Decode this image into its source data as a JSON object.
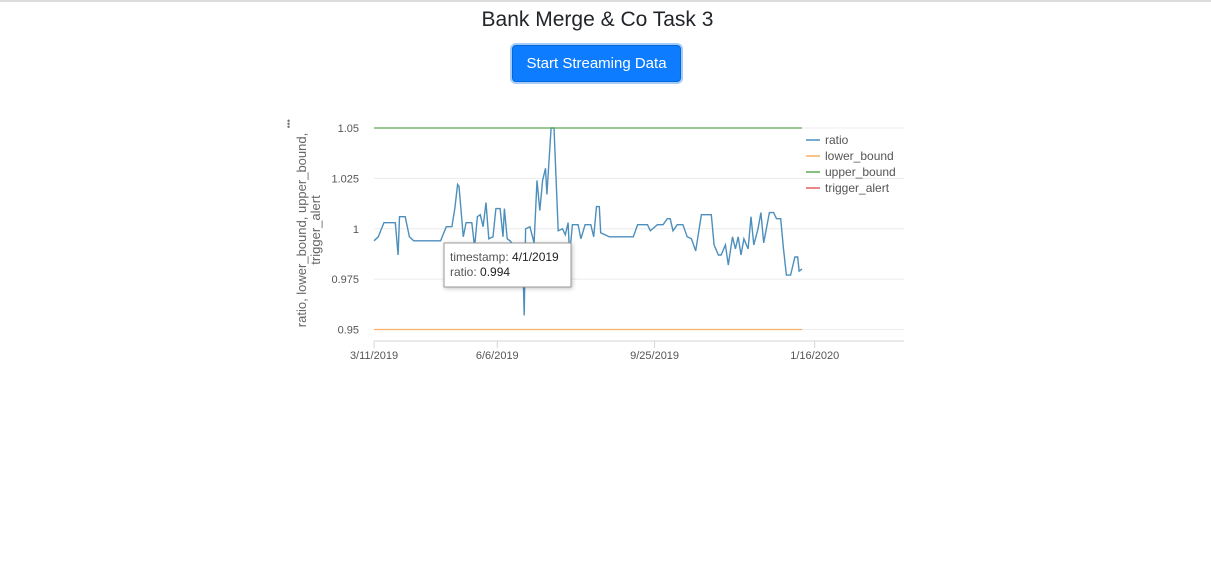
{
  "page": {
    "title": "Bank Merge & Co Task 3",
    "stream_button": "Start Streaming Data"
  },
  "colors": {
    "ratio": "#4c8fbd",
    "lower_bound": "#f5b065",
    "upper_bound": "#5cab52",
    "trigger_alert": "#e06060",
    "button": "#0d7cff"
  },
  "chart_data": {
    "type": "line",
    "title": "",
    "ylabel": "ratio, lower_bound, upper_bound, trigger_alert",
    "xlabel": "",
    "ylim": [
      0.9443,
      1.05
    ],
    "yticks": [
      "0.95",
      "0.975",
      "1",
      "1.025",
      "1.05"
    ],
    "xticks": [
      "3/11/2019",
      "6/6/2019",
      "9/25/2019",
      "1/16/2020"
    ],
    "x_range": [
      "2019-03-11",
      "2020-03-19"
    ],
    "grid": true,
    "legend_position": "top-right",
    "legend": [
      "ratio",
      "lower_bound",
      "upper_bound",
      "trigger_alert"
    ],
    "tooltip": {
      "timestamp_label": "timestamp:",
      "timestamp": "4/1/2019",
      "ratio_label": "ratio:",
      "ratio": "0.994"
    },
    "series": [
      {
        "name": "ratio",
        "points": [
          [
            "2019-03-11",
            0.994
          ],
          [
            "2019-03-14",
            0.996
          ],
          [
            "2019-03-18",
            1.003
          ],
          [
            "2019-03-26",
            1.003
          ],
          [
            "2019-03-28",
            0.987
          ],
          [
            "2019-03-29",
            1.006
          ],
          [
            "2019-04-02",
            1.006
          ],
          [
            "2019-04-05",
            0.996
          ],
          [
            "2019-04-08",
            0.994
          ],
          [
            "2019-04-20",
            0.994
          ],
          [
            "2019-04-27",
            0.994
          ],
          [
            "2019-05-01",
            1.001
          ],
          [
            "2019-05-05",
            1.001
          ],
          [
            "2019-05-07",
            1.01
          ],
          [
            "2019-05-09",
            1.022
          ],
          [
            "2019-05-10",
            1.021
          ],
          [
            "2019-05-13",
            0.996
          ],
          [
            "2019-05-15",
            1.003
          ],
          [
            "2019-05-19",
            1.003
          ],
          [
            "2019-05-21",
            0.991
          ],
          [
            "2019-05-23",
            1.006
          ],
          [
            "2019-05-25",
            1.007
          ],
          [
            "2019-05-27",
            1.001
          ],
          [
            "2019-05-29",
            1.013
          ],
          [
            "2019-05-31",
            0.995
          ],
          [
            "2019-06-03",
            0.996
          ],
          [
            "2019-06-05",
            1.01
          ],
          [
            "2019-06-08",
            1.01
          ],
          [
            "2019-06-10",
            0.996
          ],
          [
            "2019-06-11",
            1.01
          ],
          [
            "2019-06-13",
            0.995
          ],
          [
            "2019-06-15",
            0.994
          ],
          [
            "2019-06-20",
            0.99
          ],
          [
            "2019-06-24",
            0.985
          ],
          [
            "2019-06-25",
            0.957
          ],
          [
            "2019-06-26",
            1.0
          ],
          [
            "2019-06-29",
            1.001
          ],
          [
            "2019-07-02",
            0.993
          ],
          [
            "2019-07-04",
            1.024
          ],
          [
            "2019-07-06",
            1.009
          ],
          [
            "2019-07-08",
            1.024
          ],
          [
            "2019-07-10",
            1.03
          ],
          [
            "2019-07-11",
            1.017
          ],
          [
            "2019-07-14",
            1.05
          ],
          [
            "2019-07-16",
            1.05
          ],
          [
            "2019-07-19",
            0.999
          ],
          [
            "2019-07-22",
            1.0
          ],
          [
            "2019-07-24",
            0.997
          ],
          [
            "2019-07-26",
            1.003
          ],
          [
            "2019-07-27",
            0.987
          ],
          [
            "2019-07-29",
            1.002
          ],
          [
            "2019-08-02",
            1.002
          ],
          [
            "2019-08-04",
            0.995
          ],
          [
            "2019-08-07",
            1.002
          ],
          [
            "2019-08-11",
            1.002
          ],
          [
            "2019-08-13",
            0.996
          ],
          [
            "2019-08-15",
            1.011
          ],
          [
            "2019-08-17",
            1.011
          ],
          [
            "2019-08-18",
            0.998
          ],
          [
            "2019-08-21",
            0.997
          ],
          [
            "2019-08-24",
            0.996
          ],
          [
            "2019-09-01",
            0.996
          ],
          [
            "2019-09-10",
            0.996
          ],
          [
            "2019-09-13",
            1.002
          ],
          [
            "2019-09-20",
            1.002
          ],
          [
            "2019-09-22",
            0.999
          ],
          [
            "2019-09-27",
            1.002
          ],
          [
            "2019-10-01",
            1.002
          ],
          [
            "2019-10-04",
            1.005
          ],
          [
            "2019-10-06",
            1.005
          ],
          [
            "2019-10-08",
            0.999
          ],
          [
            "2019-10-11",
            1.002
          ],
          [
            "2019-10-15",
            1.002
          ],
          [
            "2019-10-18",
            0.996
          ],
          [
            "2019-10-21",
            0.995
          ],
          [
            "2019-10-24",
            0.989
          ],
          [
            "2019-10-28",
            1.007
          ],
          [
            "2019-11-04",
            1.007
          ],
          [
            "2019-11-06",
            0.992
          ],
          [
            "2019-11-09",
            0.987
          ],
          [
            "2019-11-11",
            0.987
          ],
          [
            "2019-11-14",
            0.992
          ],
          [
            "2019-11-16",
            0.982
          ],
          [
            "2019-11-19",
            0.996
          ],
          [
            "2019-11-21",
            0.99
          ],
          [
            "2019-11-23",
            0.996
          ],
          [
            "2019-11-25",
            0.987
          ],
          [
            "2019-11-27",
            0.995
          ],
          [
            "2019-11-30",
            0.99
          ],
          [
            "2019-12-02",
            1.006
          ],
          [
            "2019-12-04",
            0.992
          ],
          [
            "2019-12-07",
            1.0
          ],
          [
            "2019-12-09",
            1.008
          ],
          [
            "2019-12-11",
            0.993
          ],
          [
            "2019-12-15",
            1.008
          ],
          [
            "2019-12-18",
            1.008
          ],
          [
            "2019-12-20",
            1.005
          ],
          [
            "2019-12-23",
            1.005
          ],
          [
            "2019-12-25",
            0.99
          ],
          [
            "2019-12-27",
            0.977
          ],
          [
            "2019-12-30",
            0.977
          ],
          [
            "2020-01-02",
            0.986
          ],
          [
            "2020-01-04",
            0.986
          ],
          [
            "2020-01-05",
            0.979
          ],
          [
            "2020-01-07",
            0.98
          ]
        ]
      },
      {
        "name": "lower_bound",
        "points": [
          [
            "2019-03-11",
            0.95
          ],
          [
            "2020-01-07",
            0.95
          ]
        ]
      },
      {
        "name": "upper_bound",
        "points": [
          [
            "2019-03-11",
            1.05
          ],
          [
            "2020-01-07",
            1.05
          ]
        ]
      },
      {
        "name": "trigger_alert",
        "points": []
      }
    ]
  }
}
